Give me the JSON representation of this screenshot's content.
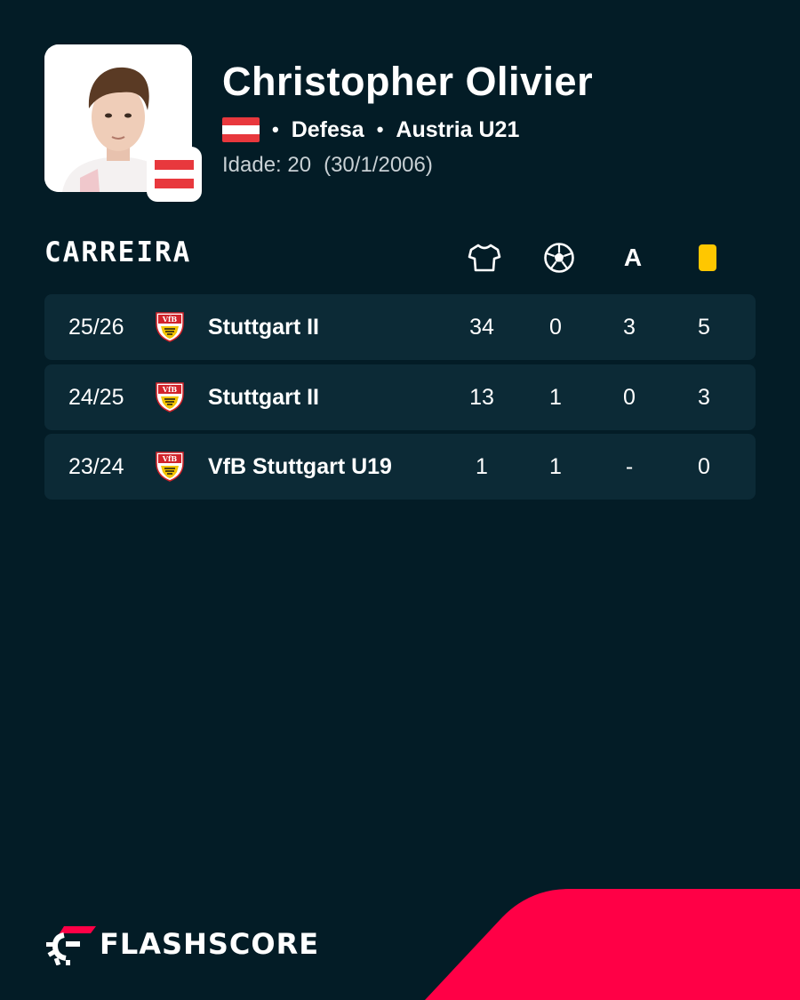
{
  "player": {
    "name": "Christopher Olivier",
    "position": "Defesa",
    "team": "Austria U21",
    "age_label": "Idade: 20",
    "birth_date": "(30/1/2006)",
    "nationality_flag": "austria-flag"
  },
  "career": {
    "title": "CARREIRA",
    "columns": [
      {
        "icon": "jersey-icon",
        "meaning": "appearances"
      },
      {
        "icon": "ball-icon",
        "meaning": "goals"
      },
      {
        "icon": "assist-icon",
        "label": "A"
      },
      {
        "icon": "yellow-card-icon",
        "meaning": "yellow cards"
      }
    ],
    "rows": [
      {
        "season": "25/26",
        "team": "Stuttgart II",
        "appearances": "34",
        "goals": "0",
        "assists": "3",
        "yellow_cards": "5"
      },
      {
        "season": "24/25",
        "team": "Stuttgart II",
        "appearances": "13",
        "goals": "1",
        "assists": "0",
        "yellow_cards": "3"
      },
      {
        "season": "23/24",
        "team": "VfB Stuttgart U19",
        "appearances": "1",
        "goals": "1",
        "assists": "-",
        "yellow_cards": "0"
      }
    ]
  },
  "brand": {
    "name": "FLASHSCORE",
    "accent_color": "#ff0046",
    "background_color": "#031c26",
    "row_color": "#0c2a36",
    "yellow_card_color": "#ffc700"
  }
}
